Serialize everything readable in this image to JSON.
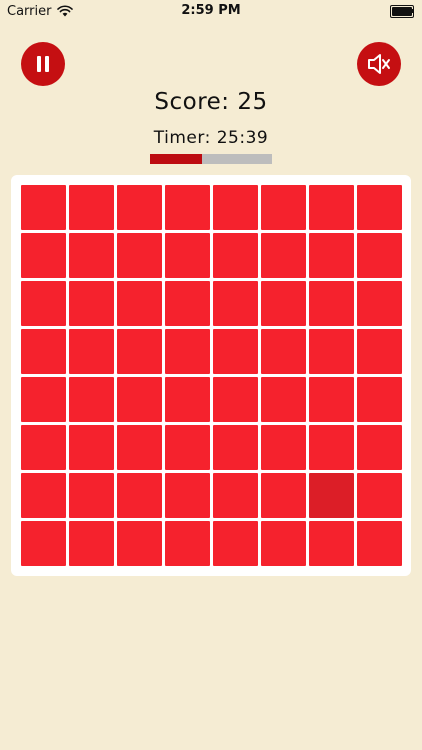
{
  "status_bar": {
    "carrier": "Carrier",
    "time": "2:59 PM",
    "battery_level": 1.0
  },
  "controls": {
    "pause_icon": "pause-icon",
    "sound_icon": "speaker-muted-icon"
  },
  "score": {
    "text": "Score: 25"
  },
  "timer": {
    "text": "Timer: 25:39",
    "progress": 0.43
  },
  "board": {
    "rows": 8,
    "cols": 8,
    "tile_color": "#f5222d",
    "odd_tile_color": "#dc1e27",
    "odd_tile": {
      "row": 6,
      "col": 6
    }
  },
  "colors": {
    "background": "#f5ecd3",
    "button": "#c50f12",
    "progress_fill": "#bd0c11",
    "progress_track": "#bdbdbd"
  }
}
